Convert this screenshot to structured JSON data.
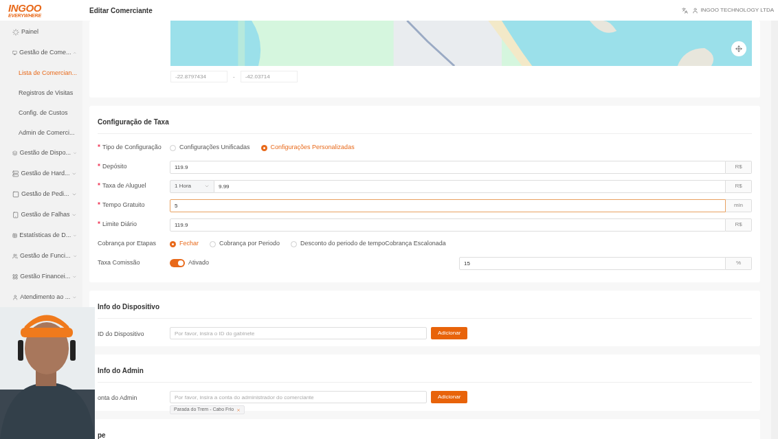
{
  "logo": {
    "name": "INGOO",
    "tagline": "EVERYWHERE"
  },
  "header": {
    "title": "Editar Comerciante",
    "company": "INGOO TECHNOLOGY LTDA"
  },
  "sidebar": {
    "items": [
      {
        "label": "Painel"
      },
      {
        "label": "Gestão de Come...",
        "expanded": true,
        "children": [
          {
            "label": "Lista de Comercian...",
            "selected": true
          },
          {
            "label": "Registros de Visitas",
            "selected": false
          },
          {
            "label": "Config. de Custos",
            "selected": false
          },
          {
            "label": "Admin de Comerci...",
            "selected": false
          }
        ]
      },
      {
        "label": "Gestão de Dispo...",
        "expanded": false
      },
      {
        "label": "Gestão de Hard...",
        "expanded": false
      },
      {
        "label": "Gestão de Pedi...",
        "expanded": false
      },
      {
        "label": "Gestão de Falhas",
        "expanded": false
      },
      {
        "label": "Estatísticas de D...",
        "expanded": false
      },
      {
        "label": "Gestão de Funci...",
        "expanded": false
      },
      {
        "label": "Gestão Financei...",
        "expanded": false
      },
      {
        "label": "Atendimento ao ...",
        "expanded": false
      }
    ]
  },
  "location": {
    "latitude": "-22.8797434",
    "separator": "-",
    "longitude": "-42.03714"
  },
  "fee_config": {
    "title": "Configuração de Taxa",
    "rows": [
      {
        "kind": "radio",
        "label": "Tipo de Configuração",
        "required": true,
        "options": [
          {
            "label": "Configurações Unificadas",
            "selected": false
          },
          {
            "label": "Configurações Personalizadas",
            "selected": true
          }
        ]
      },
      {
        "kind": "input",
        "label": "Depósito",
        "required": true,
        "value": "119.9",
        "suffix": "R$",
        "focused": false
      },
      {
        "kind": "select-input",
        "label": "Taxa de Aluguel",
        "required": true,
        "select": "1 Hora",
        "value": "9.99",
        "suffix": "R$"
      },
      {
        "kind": "input",
        "label": "Tempo Gratuito",
        "required": true,
        "value": "5",
        "suffix": "min",
        "focused": true
      },
      {
        "kind": "input",
        "label": "Limite Diário",
        "required": true,
        "value": "119.9",
        "suffix": "R$",
        "focused": false
      },
      {
        "kind": "radio",
        "label": "Cobrança por Etapas",
        "required": false,
        "options": [
          {
            "label": "Fechar",
            "selected": true
          },
          {
            "label": "Cobrança por Periodo",
            "selected": false
          },
          {
            "label": "Desconto do periodo de tempoCobrança Escalonada",
            "selected": false
          }
        ]
      },
      {
        "kind": "switch",
        "label": "Taxa Comissão",
        "required": false,
        "on": true,
        "switch_label": "Ativado",
        "value": "15",
        "suffix": "%"
      }
    ]
  },
  "device_info": {
    "title": "Info do Dispositivo",
    "label": "ID do Dispositivo",
    "placeholder": "Por favor, insira o ID do gabinete",
    "button": "Adicionar"
  },
  "admin_info": {
    "title": "Info do Admin",
    "label": "onta do Admin",
    "placeholder": "Por favor, insira a conta do administrador do comerciante",
    "button": "Adicionar",
    "tags": [
      "Parada do Trem - Cabo Frio"
    ]
  },
  "next_section": {
    "title": "pe"
  }
}
